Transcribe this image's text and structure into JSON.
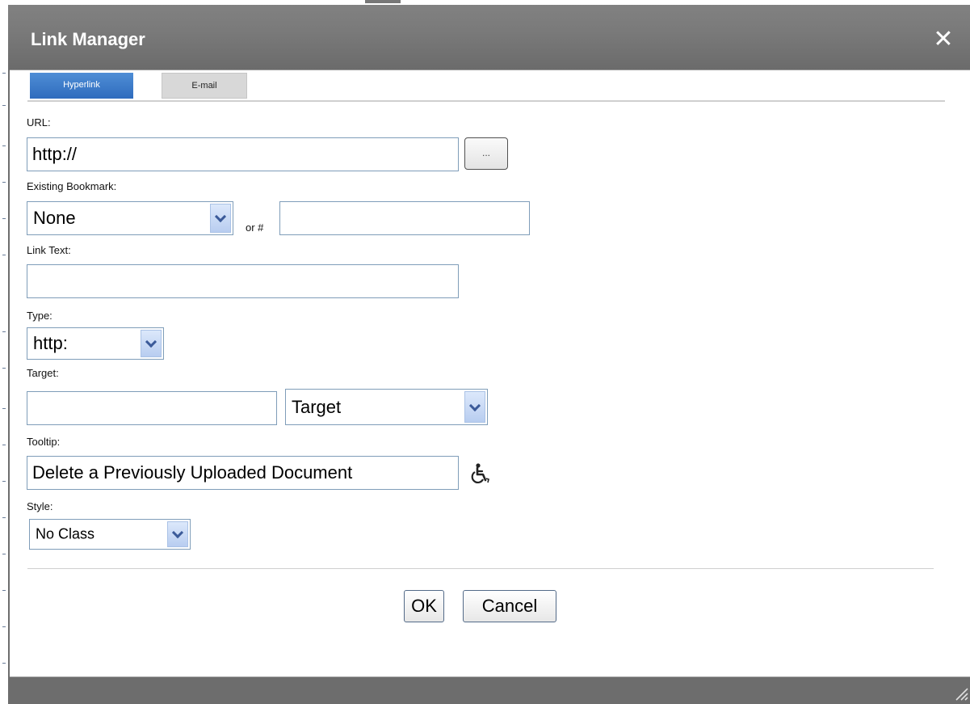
{
  "dialog": {
    "title": "Link Manager",
    "close_label": "✕"
  },
  "tabs": [
    {
      "label": "Hyperlink"
    },
    {
      "label": "E-mail"
    }
  ],
  "form": {
    "url": {
      "label": "URL:",
      "value": "http://",
      "browse_label": "..."
    },
    "bookmark": {
      "label": "Existing Bookmark:",
      "selected": "None",
      "or_label": "or #",
      "anchor_value": ""
    },
    "link_text": {
      "label": "Link Text:",
      "value": ""
    },
    "type": {
      "label": "Type:",
      "selected": "http:"
    },
    "target": {
      "label": "Target:",
      "value": "",
      "selected": "Target"
    },
    "tooltip": {
      "label": "Tooltip:",
      "value": "Delete a Previously Uploaded Document",
      "icon": "accessibility-icon"
    },
    "style": {
      "label": "Style:",
      "selected": "No Class"
    }
  },
  "buttons": {
    "ok": "OK",
    "cancel": "Cancel"
  },
  "colors": {
    "title_bar": "#757575",
    "tab_active": "#3a7acb",
    "tab_inactive": "#d8d8d8",
    "input_border": "#7f9db9"
  }
}
